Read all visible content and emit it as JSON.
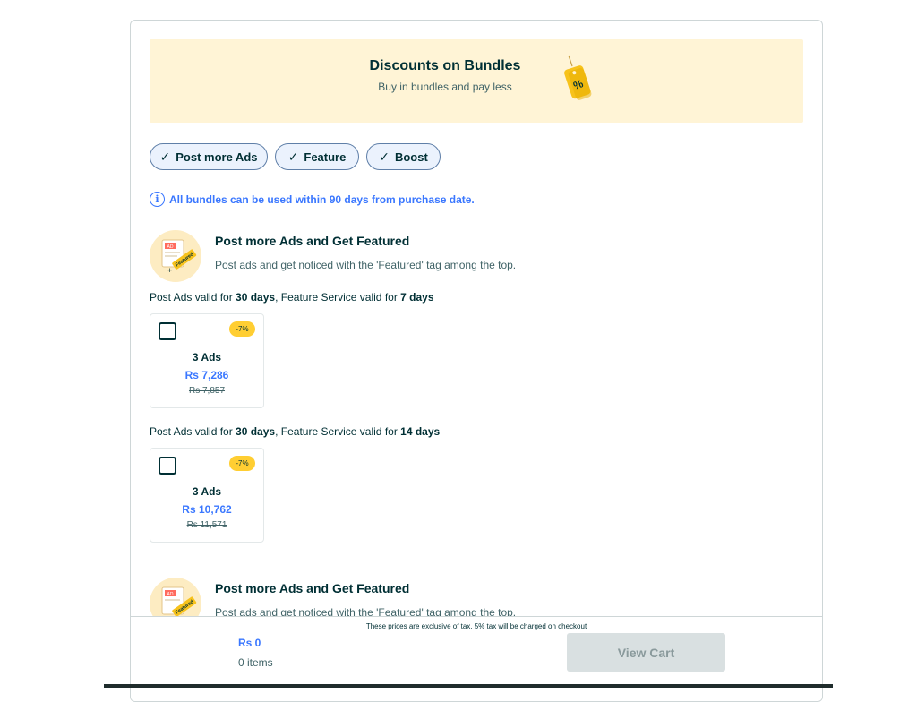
{
  "banner": {
    "title": "Discounts on Bundles",
    "subtitle": "Buy in bundles and pay less",
    "tag_symbol": "%"
  },
  "filters": [
    {
      "label": "Post more Ads",
      "icon": "check-icon"
    },
    {
      "label": "Feature",
      "icon": "check-icon"
    },
    {
      "label": "Boost",
      "icon": "check-icon"
    }
  ],
  "info": {
    "icon": "i",
    "text": "All bundles can be used within 90 days from purchase date."
  },
  "sections": [
    {
      "title": "Post more Ads and Get Featured",
      "description": "Post ads and get noticed with the 'Featured' tag among the top.",
      "image_ad_text": "AD",
      "image_featured_text": "Featured",
      "packages": [
        {
          "validity": {
            "prefix": "Post Ads valid for ",
            "ads_days": "30 days",
            "middle": ", Feature Service valid for ",
            "feature_days": "7 days"
          },
          "discount": "-7%",
          "ads": "3 Ads",
          "price": "Rs 7,286",
          "old_price": "Rs 7,857"
        },
        {
          "validity": {
            "prefix": "Post Ads valid for ",
            "ads_days": "30 days",
            "middle": ", Feature Service valid for ",
            "feature_days": "14 days"
          },
          "discount": "-7%",
          "ads": "3 Ads",
          "price": "Rs 10,762",
          "old_price": "Rs 11,571"
        }
      ]
    },
    {
      "title": "Post more Ads and Get Featured",
      "description": "Post ads and get noticed with the 'Featured' tag among the top.",
      "image_ad_text": "AD",
      "image_featured_text": "Featured"
    }
  ],
  "footer": {
    "tax_note": "These prices are exclusive of tax, 5% tax will be charged on checkout",
    "total": "Rs 0",
    "items": "0 items",
    "view_cart": "View Cart"
  },
  "colors": {
    "accent": "#3a77ff",
    "banner_bg": "#fff4d6",
    "badge": "#ffce32",
    "text": "#002f34",
    "disabled_button": "#d9e0e1"
  }
}
